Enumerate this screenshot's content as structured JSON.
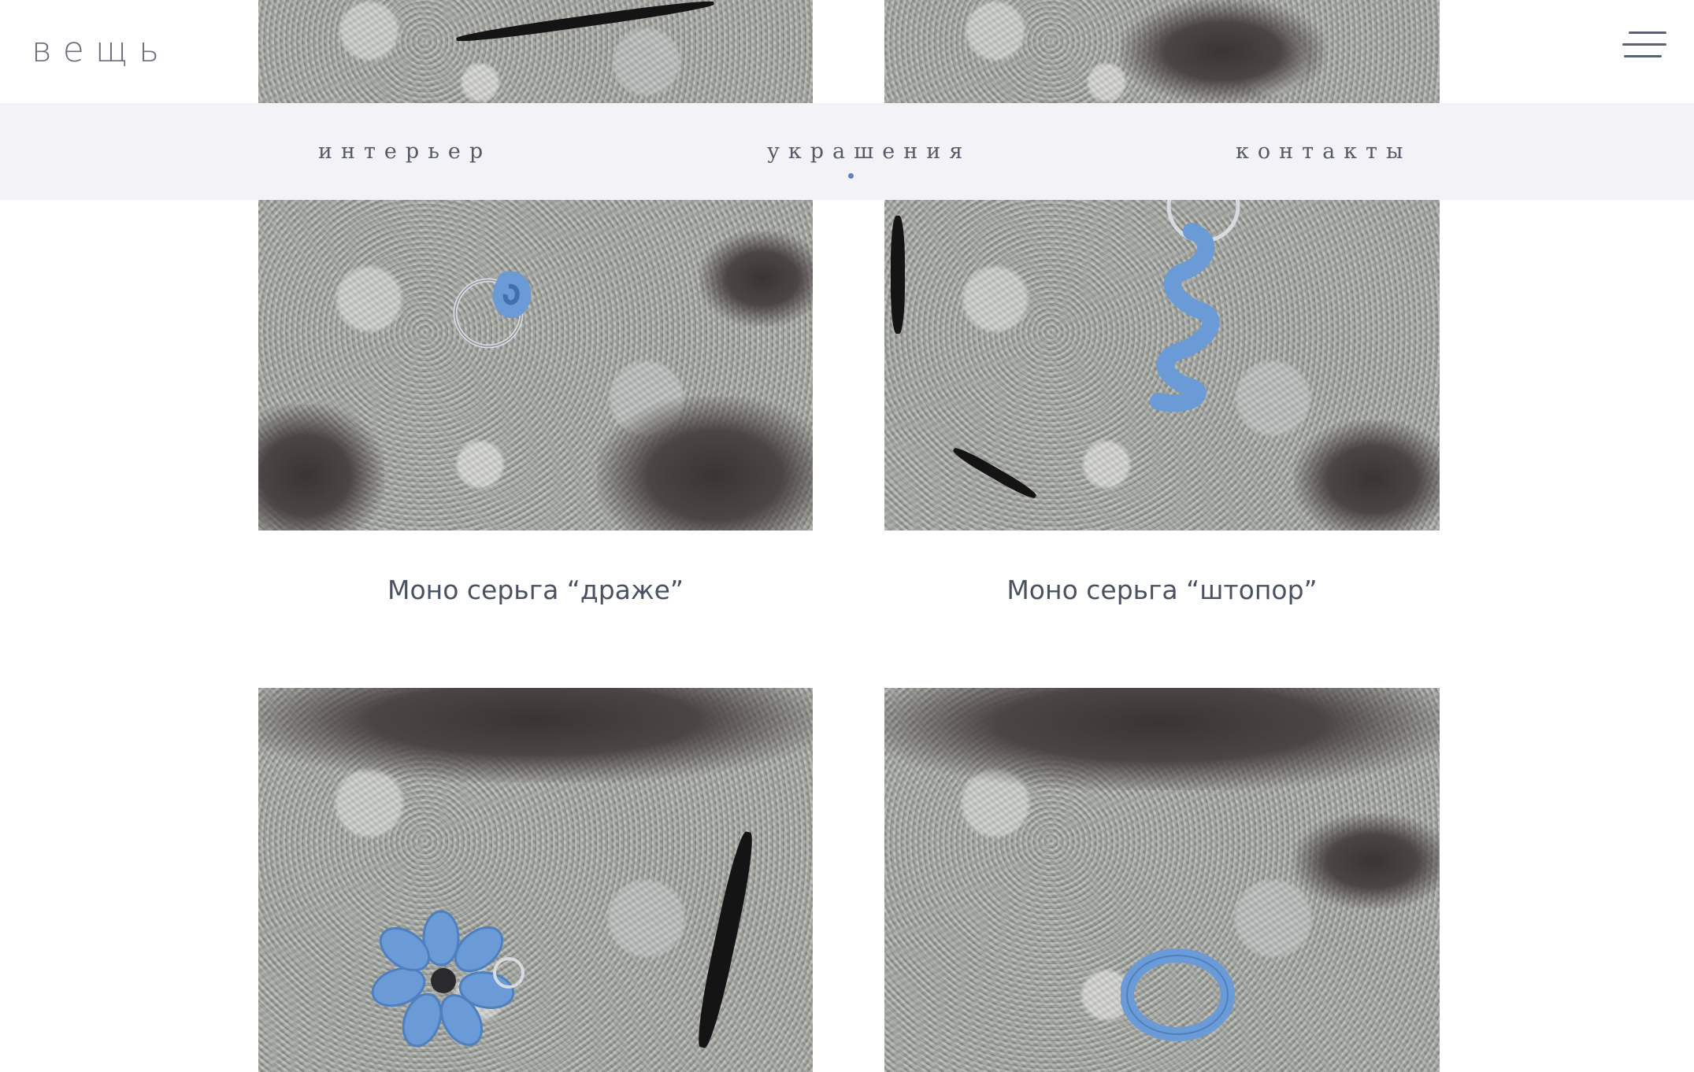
{
  "header": {
    "logo_text": "вещь",
    "menu_icon": "hamburger-menu-icon"
  },
  "nav": {
    "items": [
      {
        "label": "интерьер"
      },
      {
        "label": "украшения",
        "active": true
      },
      {
        "label": "контакты"
      }
    ],
    "active_indicator_color": "#5b82c7"
  },
  "products": [
    {
      "title": "Моно серьга “драже”",
      "image": "blue-bead-earring-on-lichen-rock"
    },
    {
      "title": "Моно серьга “штопор”",
      "image": "blue-spiral-earring-on-lichen-rock"
    },
    {
      "title": "",
      "image": "blue-flower-earring-on-lichen-rock"
    },
    {
      "title": "",
      "image": "blue-ring-on-lichen-rock"
    }
  ],
  "colors": {
    "background": "#ffffff",
    "nav_background": "#f3f2f7",
    "text": "#4a5262",
    "jewel_blue": "#6a9bd6"
  }
}
